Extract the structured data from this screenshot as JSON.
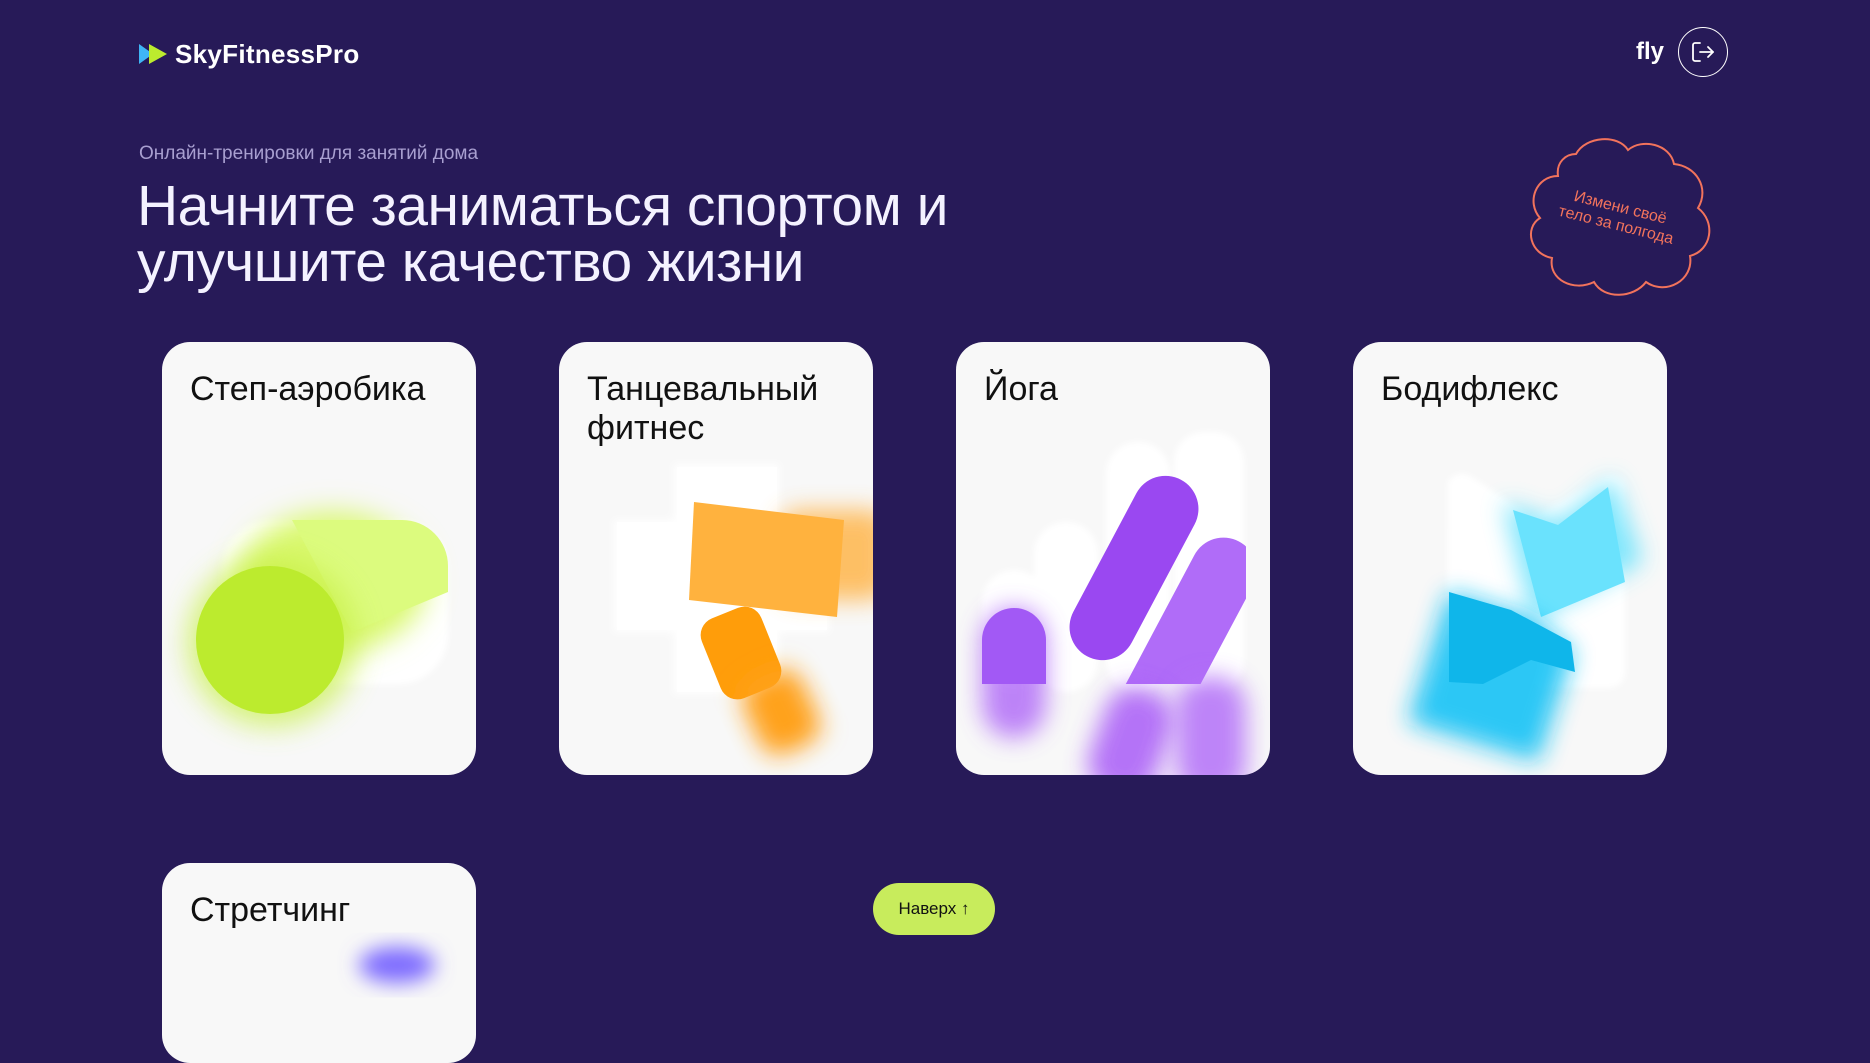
{
  "header": {
    "logo_text": "SkyFitnessPro",
    "username": "fly",
    "logout_icon": "logout-icon"
  },
  "hero": {
    "subtitle": "Онлайн-тренировки для занятий дома",
    "headline_line1": "Начните заниматься спортом и",
    "headline_line2": "улучшите качество жизни",
    "sticker_line1": "Измени своё",
    "sticker_line2": "тело за полгода"
  },
  "courses": [
    {
      "title": "Степ-аэробика",
      "color": "#bceb2e"
    },
    {
      "title": "Танцевальный фитнес",
      "color": "#ffa72c"
    },
    {
      "title": "Йога",
      "color": "#9a48f1"
    },
    {
      "title": "Бодифлекс",
      "color": "#13c2f5"
    },
    {
      "title": "Стретчинг",
      "color": "#7d6bff"
    }
  ],
  "scroll_top_button": "Наверх ↑",
  "colors": {
    "background": "#271a58",
    "accent_button": "#c8ec5c",
    "sticker": "#f2735c"
  }
}
